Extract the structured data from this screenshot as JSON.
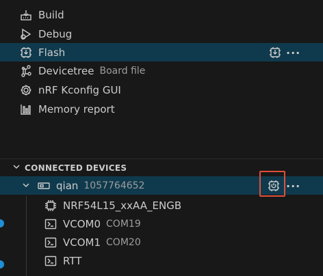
{
  "actions": [
    {
      "label": "Build",
      "icon": "build-icon"
    },
    {
      "label": "Debug",
      "icon": "debug-icon"
    },
    {
      "label": "Flash",
      "icon": "flash-icon",
      "selected": true
    },
    {
      "label": "Devicetree",
      "description": "Board file",
      "icon": "devicetree-icon"
    },
    {
      "label": "nRF Kconfig GUI",
      "icon": "gear-icon"
    },
    {
      "label": "Memory report",
      "icon": "memory-report-icon"
    }
  ],
  "flash_more": "···",
  "section": {
    "title": "CONNECTED DEVICES",
    "expanded": true
  },
  "device": {
    "name": "qian",
    "serial": "1057764652",
    "more": "···"
  },
  "device_children": [
    {
      "label": "NRF54L15_xxAA_ENGB",
      "description": "",
      "icon": "chip-icon"
    },
    {
      "label": "VCOM0",
      "description": "COM19",
      "icon": "terminal-icon"
    },
    {
      "label": "VCOM1",
      "description": "COM20",
      "icon": "terminal-icon"
    },
    {
      "label": "RTT",
      "description": "",
      "icon": "terminal-icon"
    }
  ],
  "colors": {
    "background": "#181818",
    "selected_row": "#0f3a4d",
    "highlight_border": "#e0503a",
    "gutter_dot": "#1f8fd6"
  }
}
